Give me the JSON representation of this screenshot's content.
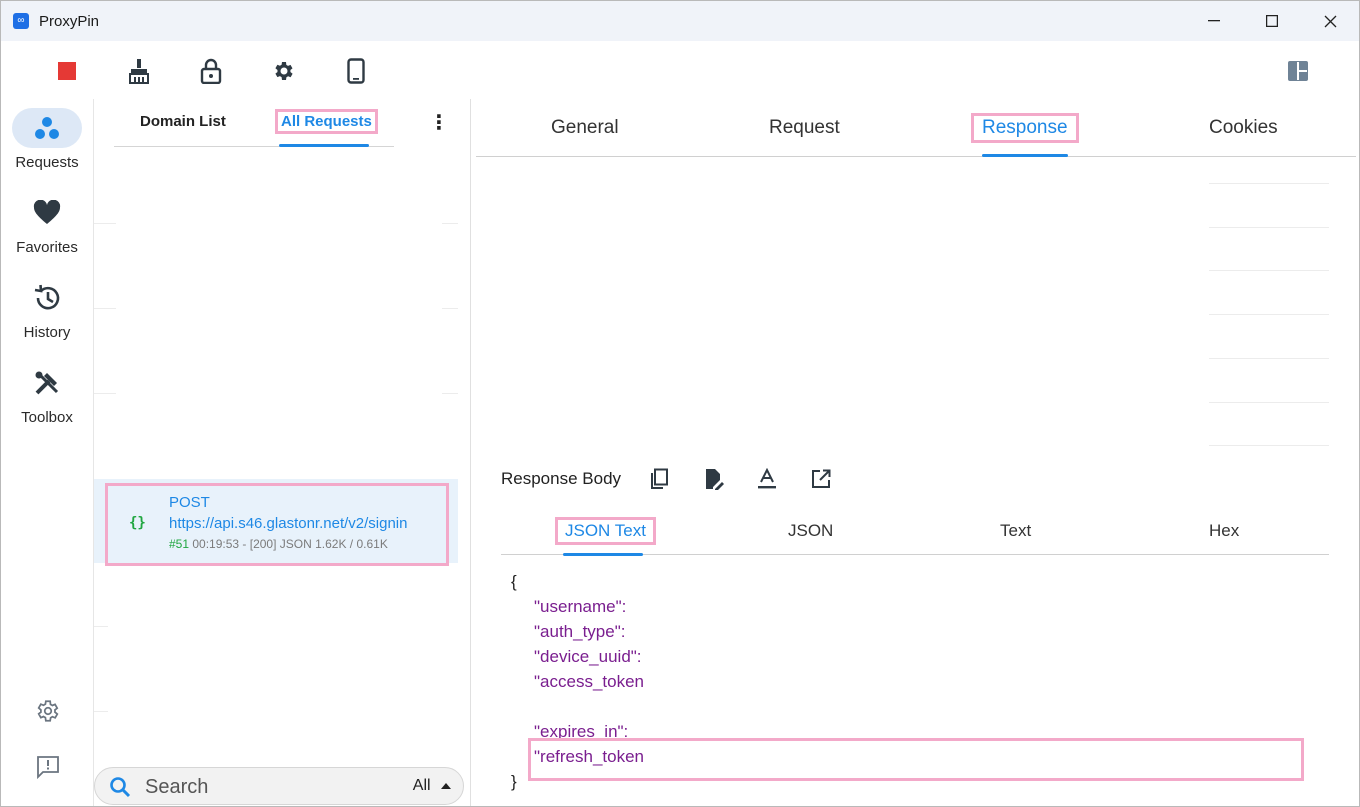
{
  "window": {
    "title": "ProxyPin",
    "minimize": "—",
    "maximize": "☐",
    "close": "✕"
  },
  "toolbar": {
    "stop": "stop-icon",
    "clean": "broom-icon",
    "https": "lock-icon",
    "settings": "gear-icon",
    "mobile": "phone-icon",
    "layout": "layout-icon"
  },
  "nav": {
    "items": [
      {
        "label": "Requests",
        "icon": "requests-icon"
      },
      {
        "label": "Favorites",
        "icon": "heart-icon"
      },
      {
        "label": "History",
        "icon": "history-icon"
      },
      {
        "label": "Toolbox",
        "icon": "toolbox-icon"
      }
    ]
  },
  "list": {
    "tabs": [
      "Domain List",
      "All Requests"
    ],
    "request": {
      "badge": "{}",
      "method_url": "POST https://api.s46.glastonr.net/v2/signin",
      "id": "#51",
      "meta": "00:19:53 - [200]  JSON 1.62K / 0.61K"
    },
    "search": {
      "placeholder": "Search",
      "filter": "All"
    }
  },
  "detail": {
    "tabs": [
      "General",
      "Request",
      "Response",
      "Cookies"
    ],
    "active_tab": "Response",
    "body_title": "Response Body",
    "body_tabs": [
      "JSON Text",
      "JSON",
      "Text",
      "Hex"
    ],
    "json_lines": [
      "{",
      "\"username\":",
      "\"auth_type\":",
      "\"device_uuid\":",
      "\"access_token",
      "",
      "\"expires_in\":",
      "\"refresh_token",
      "}"
    ]
  },
  "colors": {
    "accent": "#1e88e5",
    "highlight": "#f3a9c9",
    "stop": "#e53935",
    "json_key": "#7a1e8f"
  }
}
